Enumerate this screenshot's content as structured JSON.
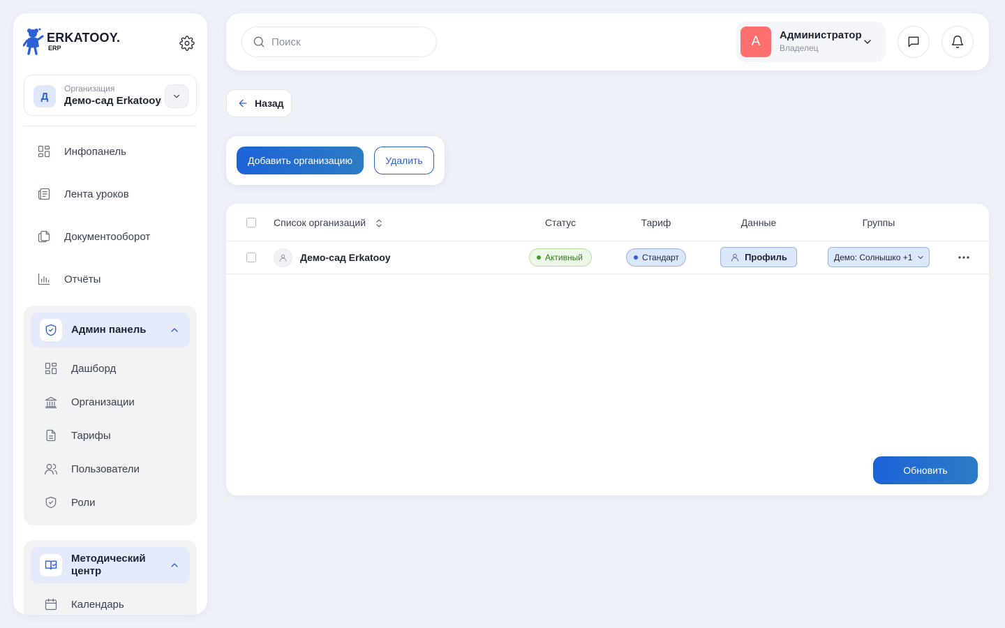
{
  "brand": {
    "name": "ERKATOOY.",
    "sub": "ERP"
  },
  "org_switcher": {
    "label": "Организация",
    "name": "Демо-сад Erkatooy",
    "initial": "Д"
  },
  "nav": [
    {
      "label": "Инфопанель",
      "icon": "grid-icon"
    },
    {
      "label": "Лента уроков",
      "icon": "newspaper-icon"
    },
    {
      "label": "Документооборот",
      "icon": "documents-icon"
    },
    {
      "label": "Отчёты",
      "icon": "bar-chart-icon"
    }
  ],
  "admin_section": {
    "title": "Админ панель",
    "icon": "shield-check-icon",
    "items": [
      {
        "label": "Дашборд",
        "icon": "grid-icon"
      },
      {
        "label": "Организации",
        "icon": "bank-icon"
      },
      {
        "label": "Тарифы",
        "icon": "document-text-icon"
      },
      {
        "label": "Пользователи",
        "icon": "users-icon"
      },
      {
        "label": "Роли",
        "icon": "shield-check-icon"
      }
    ]
  },
  "method_section": {
    "title_line1": "Методический",
    "title_line2": "центр",
    "icon": "book-check-icon",
    "items": [
      {
        "label": "Календарь",
        "icon": "calendar-icon"
      }
    ]
  },
  "search": {
    "placeholder": "Поиск"
  },
  "user": {
    "initial": "А",
    "name": "Администратор",
    "role": "Владелец",
    "avatar_color": "#ff6f6f"
  },
  "back_label": "Назад",
  "actions": {
    "add_label": "Добавить организацию",
    "delete_label": "Удалить"
  },
  "table": {
    "columns": [
      "Список организаций",
      "Статус",
      "Тариф",
      "Данные",
      "Группы"
    ],
    "rows": [
      {
        "name": "Демо-сад Erkatooy",
        "status": "Активный",
        "tariff": "Стандарт",
        "data_button": "Профиль",
        "groups": "Демо: Солнышко +1"
      }
    ]
  },
  "refresh_label": "Обновить",
  "colors": {
    "primary": "#1e62d8",
    "status_active": "#38a127",
    "tariff_dot": "#2b5fd9"
  }
}
